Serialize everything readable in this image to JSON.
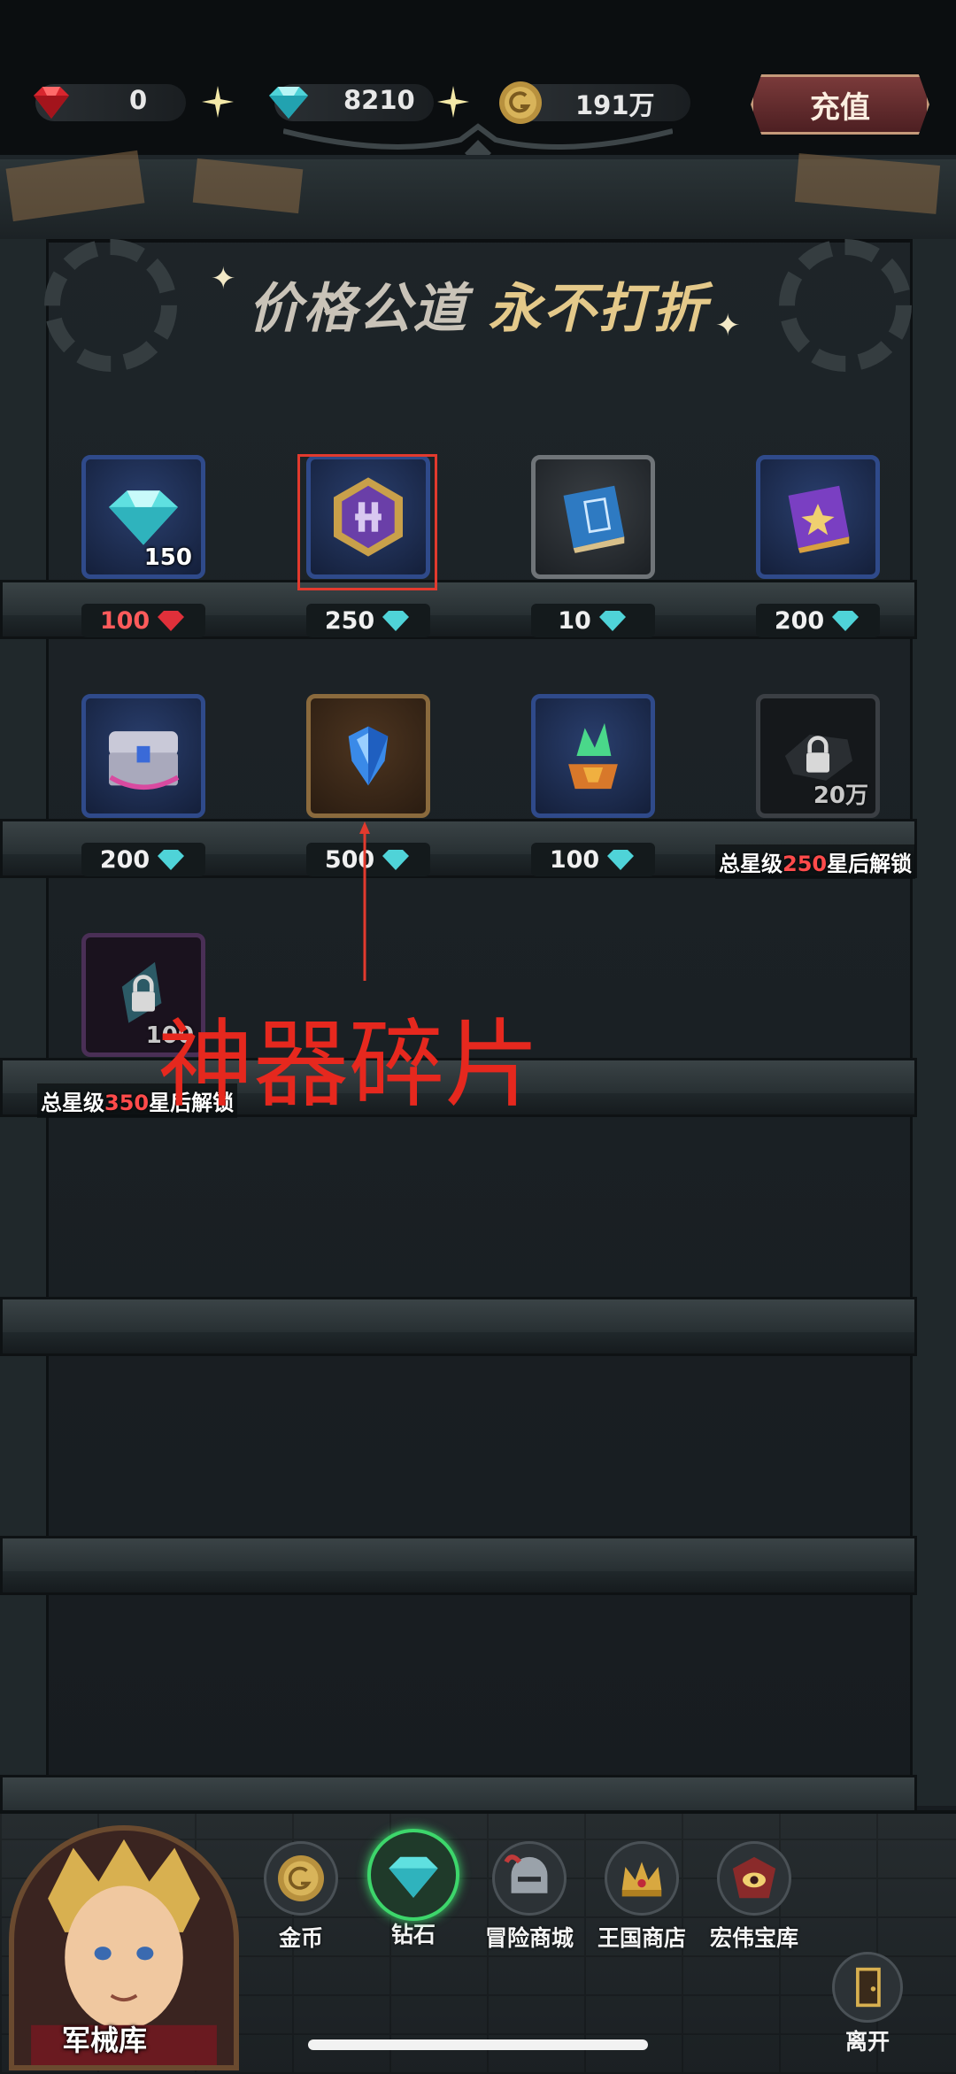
{
  "currency": {
    "ruby_value": "0",
    "diamond_value": "8210",
    "gold_value": "191万",
    "recharge_label": "充值"
  },
  "slogan": {
    "part1": "价格公道",
    "part2": "永不打折"
  },
  "items": [
    {
      "id": "diamond-pack",
      "icon": "diamond-icon",
      "quantity": "150",
      "price": "100",
      "currency": "ruby"
    },
    {
      "id": "emblem",
      "icon": "hexagon-emblem-icon",
      "quantity": "",
      "price": "250",
      "currency": "diamond"
    },
    {
      "id": "blue-book",
      "icon": "blue-book-icon",
      "quantity": "",
      "price": "10",
      "currency": "diamond"
    },
    {
      "id": "purple-book",
      "icon": "purple-book-icon",
      "quantity": "",
      "price": "200",
      "currency": "diamond"
    },
    {
      "id": "chest",
      "icon": "chest-icon",
      "quantity": "",
      "price": "200",
      "currency": "diamond"
    },
    {
      "id": "blue-crystal",
      "icon": "blue-crystal-icon",
      "quantity": "",
      "price": "500",
      "currency": "diamond"
    },
    {
      "id": "green-crystal",
      "icon": "green-crystal-icon",
      "quantity": "",
      "price": "100",
      "currency": "diamond"
    },
    {
      "id": "locked-stone",
      "icon": "lock-icon",
      "quantity": "20万",
      "unlock_prefix": "总星级",
      "unlock_num": "250",
      "unlock_suffix": "星后解锁"
    },
    {
      "id": "locked-shard",
      "icon": "lock-icon",
      "quantity": "100",
      "unlock_prefix": "总星级",
      "unlock_num": "350",
      "unlock_suffix": "星后解锁"
    }
  ],
  "annotation": {
    "text": "神器碎片",
    "color": "#e6281e"
  },
  "nav": {
    "portrait_label": "军械库",
    "tabs": [
      {
        "label": "金币",
        "icon": "gold-coin-icon"
      },
      {
        "label": "钻石",
        "icon": "diamond-icon",
        "active": true
      },
      {
        "label": "冒险商城",
        "icon": "knight-helmet-icon"
      },
      {
        "label": "王国商店",
        "icon": "crown-icon"
      },
      {
        "label": "宏伟宝库",
        "icon": "treasure-eye-icon"
      }
    ],
    "leave_label": "离开"
  }
}
